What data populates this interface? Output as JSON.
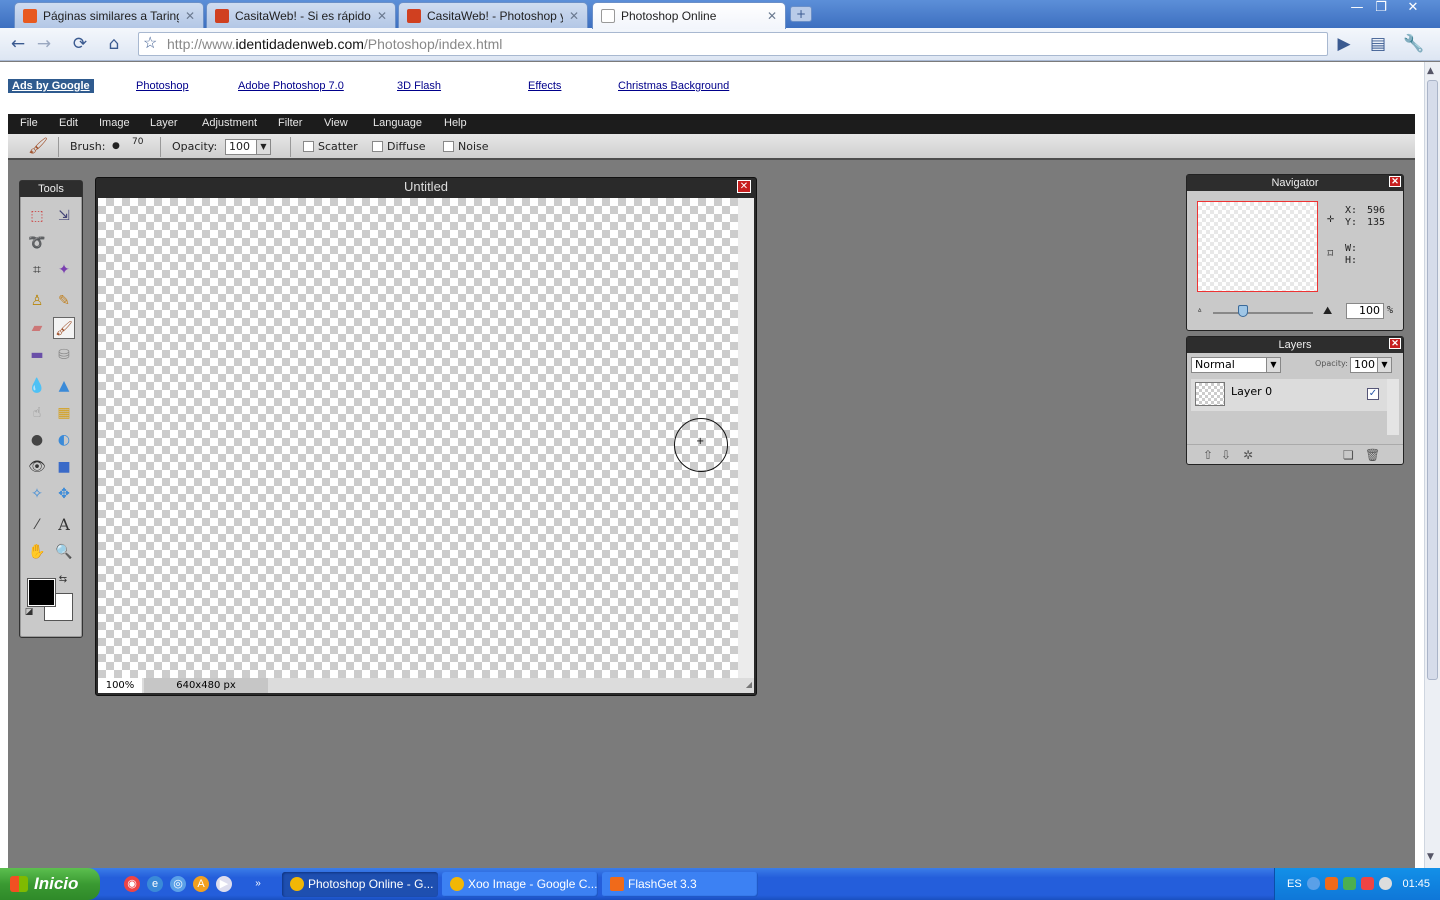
{
  "browser": {
    "tabs": [
      {
        "label": "Páginas similares a Taringa ...",
        "favicon_color": "#e8591f"
      },
      {
        "label": "CasitaWeb! - Si es rápido y...",
        "favicon_color": "#d04020"
      },
      {
        "label": "CasitaWeb! - Photoshop y ...",
        "favicon_color": "#d04020"
      },
      {
        "label": "Photoshop Online",
        "favicon_color": "#ffffff"
      }
    ],
    "url_prefix": "http://www.",
    "url_domain": "identidadenweb.com",
    "url_path": "/Photoshop/index.html"
  },
  "ads": {
    "brand": "Ads by Google",
    "links": [
      "Photoshop",
      "Adobe Photoshop 7.0",
      "3D Flash",
      "Effects",
      "Christmas Background"
    ]
  },
  "menu": [
    "File",
    "Edit",
    "Image",
    "Layer",
    "Adjustment",
    "Filter",
    "View",
    "Language",
    "Help"
  ],
  "options": {
    "brush_label": "Brush:",
    "brush_size": "70",
    "opacity_label": "Opacity:",
    "opacity_value": "100",
    "scatter": "Scatter",
    "diffuse": "Diffuse",
    "noise": "Noise"
  },
  "tools_panel": {
    "title": "Tools"
  },
  "document": {
    "title": "Untitled",
    "zoom": "100%",
    "dimensions": "640x480 px"
  },
  "navigator": {
    "title": "Navigator",
    "x_label": "X:",
    "x_value": "596",
    "y_label": "Y:",
    "y_value": "135",
    "w_label": "W:",
    "h_label": "H:",
    "zoom_value": "100",
    "zoom_unit": "%",
    "zoom_level": 0.3
  },
  "layers": {
    "title": "Layers",
    "blend_mode": "Normal",
    "opacity_label": "Opacity:",
    "opacity_value": "100",
    "items": [
      {
        "name": "Layer 0",
        "visible": true
      }
    ]
  },
  "taskbar": {
    "start_label": "Inicio",
    "tasks": [
      {
        "label": "Photoshop Online - G...",
        "active": true,
        "icon_color": "#f2b705"
      },
      {
        "label": "Xoo Image - Google C...",
        "active": false,
        "icon_color": "#f2b705"
      },
      {
        "label": "FlashGet 3.3",
        "active": false,
        "icon_color": "#f06a1a"
      }
    ],
    "tray_language": "ES",
    "clock": "01:45"
  }
}
